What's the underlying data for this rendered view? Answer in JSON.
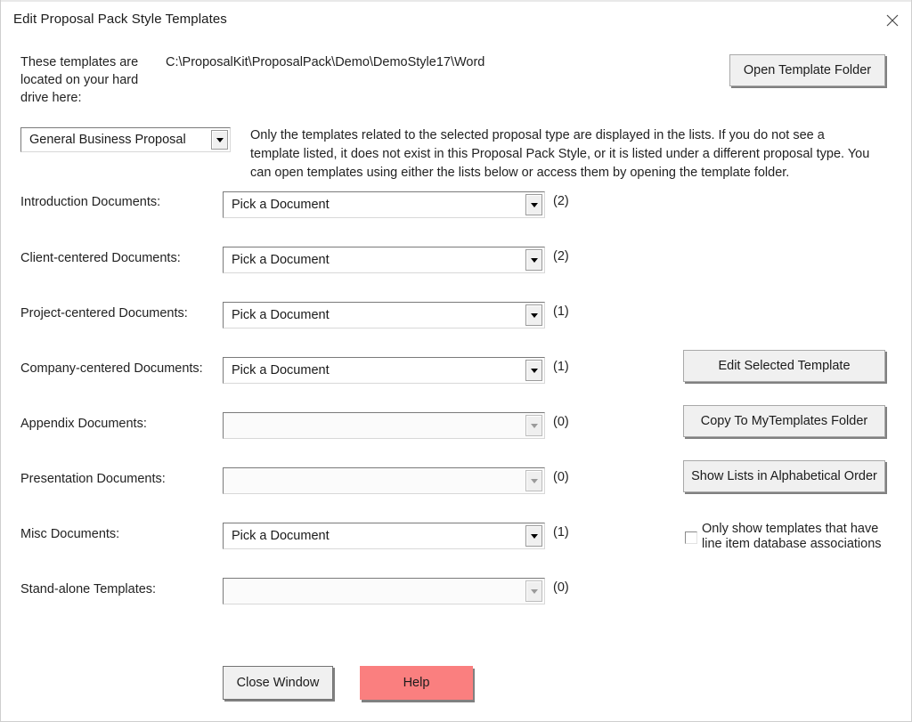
{
  "window": {
    "title": "Edit Proposal Pack Style Templates",
    "close_icon": "close-icon"
  },
  "header": {
    "location_label": "These templates are located on your hard drive here:",
    "path": "C:\\ProposalKit\\ProposalPack\\Demo\\DemoStyle17\\Word",
    "open_folder_button": "Open Template Folder"
  },
  "proposal_type": {
    "selected": "General Business Proposal",
    "arrow_icon": "chevron-down-icon"
  },
  "instructions": "Only the templates related to the selected proposal type are displayed in the lists.  If you do not see a template listed, it does not exist in this Proposal Pack Style, or it is listed under a different proposal type. You can open templates using either the lists below or access them by opening the template folder.",
  "document_rows": [
    {
      "label": "Introduction Documents:",
      "value": "Pick a Document",
      "count": "(2)",
      "enabled": true
    },
    {
      "label": "Client-centered Documents:",
      "value": "Pick a Document",
      "count": "(2)",
      "enabled": true
    },
    {
      "label": "Project-centered Documents:",
      "value": "Pick a Document",
      "count": "(1)",
      "enabled": true
    },
    {
      "label": "Company-centered Documents:",
      "value": "Pick a Document",
      "count": "(1)",
      "enabled": true
    },
    {
      "label": "Appendix Documents:",
      "value": "",
      "count": "(0)",
      "enabled": false
    },
    {
      "label": "Presentation Documents:",
      "value": "",
      "count": "(0)",
      "enabled": false
    },
    {
      "label": "Misc Documents:",
      "value": "Pick a Document",
      "count": "(1)",
      "enabled": true
    },
    {
      "label": "Stand-alone Templates:",
      "value": "",
      "count": "(0)",
      "enabled": false
    }
  ],
  "side_actions": {
    "edit_selected": "Edit Selected Template",
    "copy_to_mytemplates": "Copy To MyTemplates Folder",
    "show_alphabetical": "Show Lists in Alphabetical Order",
    "filter_checkbox_line1": "Only show templates that have",
    "filter_checkbox_line2": "line item database associations",
    "filter_checked": false
  },
  "footer": {
    "close_window": "Close Window",
    "help": "Help"
  },
  "colors": {
    "help_button": "#fa7f7f",
    "button_face": "#f0f0f0",
    "button_shadow": "#808080",
    "text": "#222222"
  }
}
